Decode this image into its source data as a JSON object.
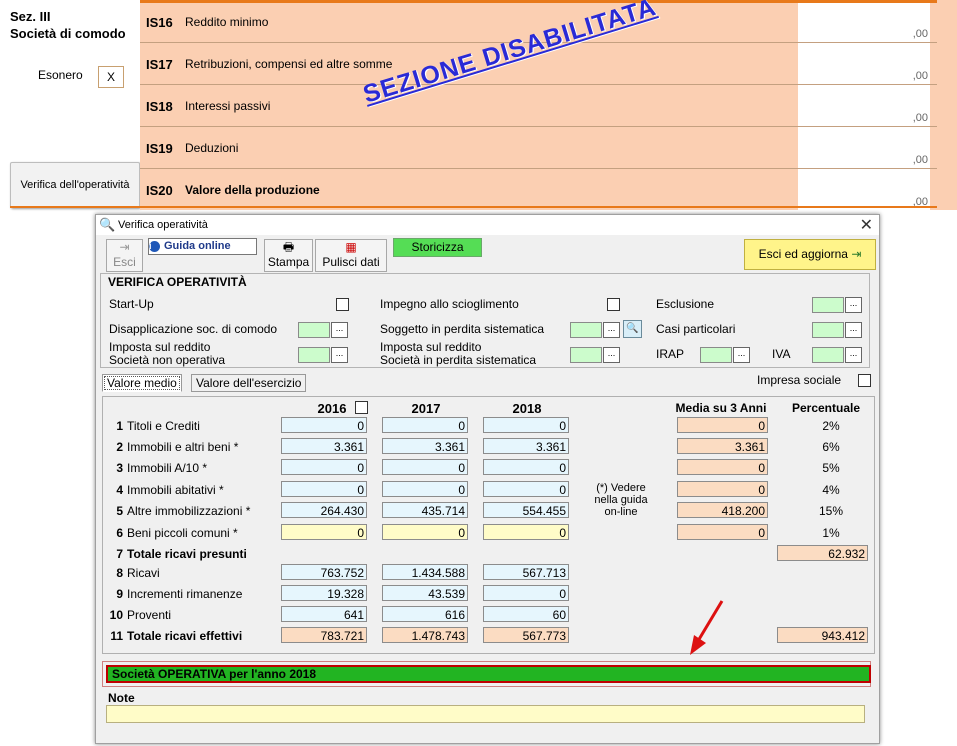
{
  "background_form": {
    "section_title_line1": "Sez. III",
    "section_title_line2": "Società di comodo",
    "esonero_label": "Esonero",
    "esonero_value": "X",
    "verifica_button": "Verifica dell'operatività",
    "disabled_stamp": "SEZIONE DISABILITATA",
    "rows": [
      {
        "code": "IS16",
        "label": "Reddito minimo",
        "amount": ",00"
      },
      {
        "code": "IS17",
        "label": "Retribuzioni, compensi ed altre somme",
        "amount": ",00"
      },
      {
        "code": "IS18",
        "label": "Interessi passivi",
        "amount": ",00"
      },
      {
        "code": "IS19",
        "label": "Deduzioni",
        "amount": ",00"
      },
      {
        "code": "IS20",
        "label": "Valore della produzione",
        "amount": ",00"
      }
    ]
  },
  "dialog": {
    "title": "Verifica operatività",
    "close_glyph": "✕",
    "toolbar": {
      "esci": "Esci",
      "guida": "Guida online",
      "stampa": "Stampa",
      "pulisci": "Pulisci dati",
      "storicizza": "Storicizza",
      "esci_aggiorna": "Esci ed aggiorna"
    },
    "verifica": {
      "title": "VERIFICA OPERATIVITÀ",
      "start_up": "Start-Up",
      "impegno": "Impegno allo scioglimento",
      "esclusione": "Esclusione",
      "disapplicazione": "Disapplicazione soc. di comodo",
      "soggetto": "Soggetto in perdita sistematica",
      "casi": "Casi particolari",
      "imposta_nonop_1": "Imposta sul reddito",
      "imposta_nonop_2": "Società non operativa",
      "imposta_perdita_1": "Imposta sul reddito",
      "imposta_perdita_2": "Società in perdita sistematica",
      "irap": "IRAP",
      "iva": "IVA",
      "dots": "..."
    },
    "tabs": [
      "Valore medio",
      "Valore dell'esercizio"
    ],
    "impresa_sociale": "Impresa sociale",
    "columns": {
      "y2016": "2016",
      "y2017": "2017",
      "y2018": "2018",
      "media": "Media su 3 Anni",
      "percentuale": "Percentuale"
    },
    "vedere_note_1": "(*) Vedere",
    "vedere_note_2": "nella guida",
    "vedere_note_3": "on-line",
    "rows": [
      {
        "n": "1",
        "label": "Titoli e Crediti",
        "v2016": "0",
        "v2017": "0",
        "v2018": "0",
        "media": "0",
        "pct": "2%"
      },
      {
        "n": "2",
        "label": "Immobili e altri beni *",
        "v2016": "3.361",
        "v2017": "3.361",
        "v2018": "3.361",
        "media": "3.361",
        "pct": "6%"
      },
      {
        "n": "3",
        "label": "Immobili A/10 *",
        "v2016": "0",
        "v2017": "0",
        "v2018": "0",
        "media": "0",
        "pct": "5%"
      },
      {
        "n": "4",
        "label": "Immobili abitativi *",
        "v2016": "0",
        "v2017": "0",
        "v2018": "0",
        "media": "0",
        "pct": "4%"
      },
      {
        "n": "5",
        "label": "Altre immobilizzazioni *",
        "v2016": "264.430",
        "v2017": "435.714",
        "v2018": "554.455",
        "media": "418.200",
        "pct": "15%"
      },
      {
        "n": "6",
        "label": "Beni piccoli comuni *",
        "v2016": "0",
        "v2017": "0",
        "v2018": "0",
        "media": "0",
        "pct": "1%"
      },
      {
        "n": "7",
        "label": "Totale ricavi presunti",
        "total": "62.932"
      },
      {
        "n": "8",
        "label": "Ricavi",
        "v2016": "763.752",
        "v2017": "1.434.588",
        "v2018": "567.713"
      },
      {
        "n": "9",
        "label": "Incrementi rimanenze",
        "v2016": "19.328",
        "v2017": "43.539",
        "v2018": "0"
      },
      {
        "n": "10",
        "label": "Proventi",
        "v2016": "641",
        "v2017": "616",
        "v2018": "60"
      },
      {
        "n": "11",
        "label": "Totale ricavi effettivi",
        "v2016": "783.721",
        "v2017": "1.478.743",
        "v2018": "567.773",
        "total": "943.412"
      }
    ],
    "result": "Società OPERATIVA per l'anno 2018",
    "note_label": "Note",
    "note_value": "",
    "colors": {
      "result_green": "#22b422",
      "result_border": "#c00000",
      "arrow": "#dd1111"
    }
  }
}
